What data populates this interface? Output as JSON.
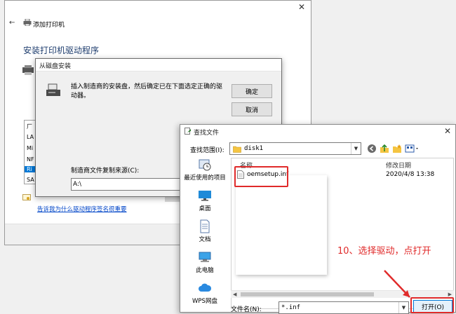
{
  "wizard": {
    "title": "添加打印机",
    "heading": "安装打印机驱动程序",
    "manufacturer_rows": [
      "厂",
      "LA",
      "Mi",
      "NF",
      "Ri",
      "SA"
    ],
    "selected_row_index": 4,
    "link": "告诉我为什么驱动程序签名很重要"
  },
  "install_disk": {
    "title": "从磁盘安装",
    "message": "插入制造商的安装盘，然后确定已在下面选定正确的驱动器。",
    "ok_label": "确定",
    "cancel_label": "取消",
    "copy_from_label": "制造商文件复制来源(C):",
    "copy_from_value": "A:\\"
  },
  "find_file": {
    "title": "查找文件",
    "look_in_label": "查找范围(I):",
    "look_in_value": "disk1",
    "places": [
      {
        "label": "最近使用的项目",
        "icon": "recent-icon"
      },
      {
        "label": "桌面",
        "icon": "desktop-icon"
      },
      {
        "label": "文档",
        "icon": "documents-icon"
      },
      {
        "label": "此电脑",
        "icon": "computer-icon"
      },
      {
        "label": "WPS网盘",
        "icon": "cloud-icon"
      }
    ],
    "columns": {
      "name": "名称",
      "date": "修改日期"
    },
    "files": [
      {
        "name": "oemsetup.inf",
        "date": "2020/4/8 13:38",
        "icon": "inf-file-icon"
      }
    ],
    "file_name_label": "文件名(N):",
    "file_name_value": "*.inf",
    "open_label": "打开(O)"
  },
  "annotation": {
    "text": "10、选择驱动，点打开",
    "color": "#e02a2a"
  },
  "colors": {
    "accent": "#0078d7",
    "link": "#0045c8",
    "heading": "#1e3d6e"
  }
}
